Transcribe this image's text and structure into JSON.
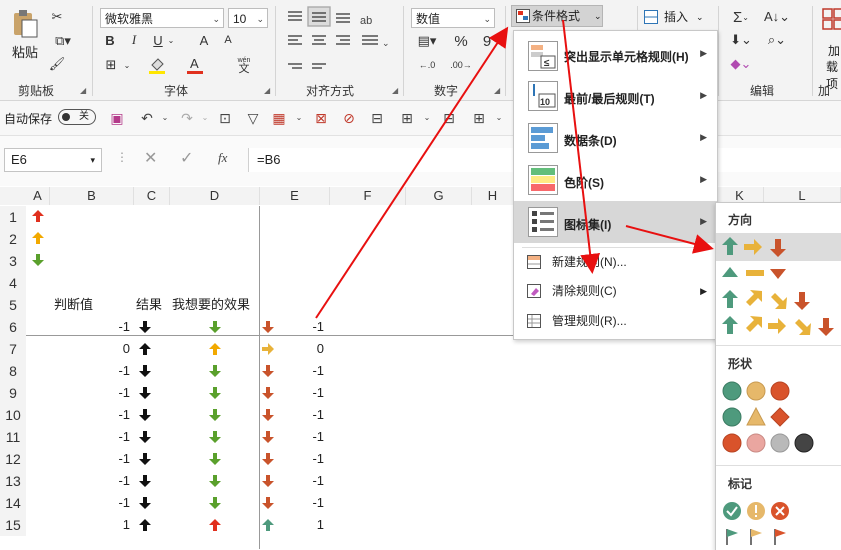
{
  "ribbon": {
    "paste": "粘贴",
    "clipboard": "剪贴板",
    "font_name": "微软雅黑",
    "font_size": "10",
    "font_group": "字体",
    "align_group": "对齐方式",
    "number_format": "数值",
    "number_group": "数字",
    "cond_format": "条件格式",
    "insert": "插入",
    "edit_group": "编辑",
    "addin_1": "加",
    "addin_2": "载项",
    "addin_group": "加载",
    "bold": "B",
    "italic": "I",
    "underline": "U",
    "font_inc": "A",
    "font_dec": "A",
    "percent": "%",
    "comma": "9",
    "phonetic": "wén",
    "phonetic2": "文",
    "sum": "Σ"
  },
  "qat": {
    "autosave": "自动保存",
    "autosave_state": "关"
  },
  "formula_bar": {
    "name_box": "E6",
    "fx": "fx",
    "formula": "=B6"
  },
  "grid": {
    "columns": [
      "A",
      "B",
      "C",
      "D",
      "E",
      "F",
      "G",
      "H",
      "K",
      "L"
    ],
    "rows": [
      "1",
      "2",
      "3",
      "4",
      "5",
      "6",
      "7",
      "8",
      "9",
      "10",
      "11",
      "12",
      "13",
      "14",
      "15"
    ],
    "headers": {
      "b": "判断值",
      "c": "结果",
      "d": "我想要的效果"
    },
    "b_values": [
      "-1",
      "0",
      "-1",
      "-1",
      "-1",
      "-1",
      "-1",
      "-1",
      "-1",
      "1"
    ],
    "e_values": [
      "-1",
      "0",
      "-1",
      "-1",
      "-1",
      "-1",
      "-1",
      "-1",
      "-1",
      "1"
    ]
  },
  "menu": {
    "items": [
      {
        "label": "突出显示单元格规则(H)"
      },
      {
        "label": "最前/最后规则(T)"
      },
      {
        "label": "数据条(D)"
      },
      {
        "label": "色阶(S)"
      },
      {
        "label": "图标集(I)"
      }
    ],
    "simple": [
      {
        "label": "新建规则(N)..."
      },
      {
        "label": "清除规则(C)"
      },
      {
        "label": "管理规则(R)..."
      }
    ],
    "icon_10": "10"
  },
  "submenu": {
    "direction": "方向",
    "shapes": "形状",
    "markers": "标记"
  },
  "colors": {
    "red": "#e0301e",
    "green": "#4f9a5a",
    "orange": "#e8a03a",
    "teal": "#4e9a7d",
    "highlight": "#d7d7d7"
  }
}
